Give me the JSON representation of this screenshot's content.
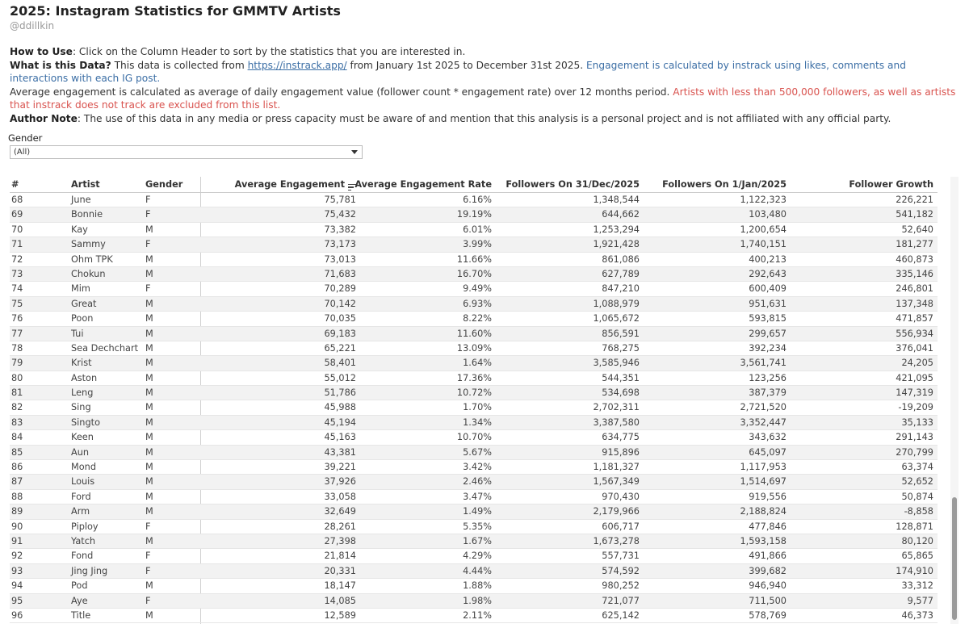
{
  "header": {
    "title": "2025: Instagram Statistics for GMMTV Artists",
    "handle": "@ddillkin"
  },
  "description": {
    "how_label": "How to Use",
    "how_text": ": Click on the Column Header to sort by the statistics that you are interested in.",
    "what_label": "What is this Data?",
    "what_text_1": " This data is collected from ",
    "what_link": "https://instrack.app/",
    "what_text_2": " from January 1st 2025 to December 31st 2025. ",
    "what_engagement": "Engagement is calculated by instrack using likes, comments and interactions with each IG post.",
    "avg_text": "Average engagement is calculated as average of daily engagement value (follower count * engagement rate) over 12 months period. ",
    "avg_red": "Artists with less than 500,000 followers, as well as artists that instrack does not track are excluded from this list.",
    "author_label": "Author Note",
    "author_text": ": The use of this data in any media or press capacity must be aware of and mention that this analysis is a personal project and is not affiliated with any official party."
  },
  "filter": {
    "label": "Gender",
    "value": "(All)"
  },
  "table": {
    "columns": {
      "num": "#",
      "artist": "Artist",
      "gender": "Gender",
      "avg": "Average Engagement",
      "rate": "Average Engagement Rate",
      "f31": "Followers On 31/Dec/2025",
      "f1": "Followers On 1/Jan/2025",
      "growth": "Follower Growth"
    },
    "rows": [
      [
        "68",
        "June",
        "F",
        "75,781",
        "6.16%",
        "1,348,544",
        "1,122,323",
        "226,221"
      ],
      [
        "69",
        "Bonnie",
        "F",
        "75,432",
        "19.19%",
        "644,662",
        "103,480",
        "541,182"
      ],
      [
        "70",
        "Kay",
        "M",
        "73,382",
        "6.01%",
        "1,253,294",
        "1,200,654",
        "52,640"
      ],
      [
        "71",
        "Sammy",
        "F",
        "73,173",
        "3.99%",
        "1,921,428",
        "1,740,151",
        "181,277"
      ],
      [
        "72",
        "Ohm TPK",
        "M",
        "73,013",
        "11.66%",
        "861,086",
        "400,213",
        "460,873"
      ],
      [
        "73",
        "Chokun",
        "M",
        "71,683",
        "16.70%",
        "627,789",
        "292,643",
        "335,146"
      ],
      [
        "74",
        "Mim",
        "F",
        "70,289",
        "9.49%",
        "847,210",
        "600,409",
        "246,801"
      ],
      [
        "75",
        "Great",
        "M",
        "70,142",
        "6.93%",
        "1,088,979",
        "951,631",
        "137,348"
      ],
      [
        "76",
        "Poon",
        "M",
        "70,035",
        "8.22%",
        "1,065,672",
        "593,815",
        "471,857"
      ],
      [
        "77",
        "Tui",
        "M",
        "69,183",
        "11.60%",
        "856,591",
        "299,657",
        "556,934"
      ],
      [
        "78",
        "Sea Dechchart",
        "M",
        "65,221",
        "13.09%",
        "768,275",
        "392,234",
        "376,041"
      ],
      [
        "79",
        "Krist",
        "M",
        "58,401",
        "1.64%",
        "3,585,946",
        "3,561,741",
        "24,205"
      ],
      [
        "80",
        "Aston",
        "M",
        "55,012",
        "17.36%",
        "544,351",
        "123,256",
        "421,095"
      ],
      [
        "81",
        "Leng",
        "M",
        "51,786",
        "10.72%",
        "534,698",
        "387,379",
        "147,319"
      ],
      [
        "82",
        "Sing",
        "M",
        "45,988",
        "1.70%",
        "2,702,311",
        "2,721,520",
        "-19,209"
      ],
      [
        "83",
        "Singto",
        "M",
        "45,194",
        "1.34%",
        "3,387,580",
        "3,352,447",
        "35,133"
      ],
      [
        "84",
        "Keen",
        "M",
        "45,163",
        "10.70%",
        "634,775",
        "343,632",
        "291,143"
      ],
      [
        "85",
        "Aun",
        "M",
        "43,381",
        "5.67%",
        "915,896",
        "645,097",
        "270,799"
      ],
      [
        "86",
        "Mond",
        "M",
        "39,221",
        "3.42%",
        "1,181,327",
        "1,117,953",
        "63,374"
      ],
      [
        "87",
        "Louis",
        "M",
        "37,926",
        "2.46%",
        "1,567,349",
        "1,514,697",
        "52,652"
      ],
      [
        "88",
        "Ford",
        "M",
        "33,058",
        "3.47%",
        "970,430",
        "919,556",
        "50,874"
      ],
      [
        "89",
        "Arm",
        "M",
        "32,649",
        "1.49%",
        "2,179,966",
        "2,188,824",
        "-8,858"
      ],
      [
        "90",
        "Piploy",
        "F",
        "28,261",
        "5.35%",
        "606,717",
        "477,846",
        "128,871"
      ],
      [
        "91",
        "Yatch",
        "M",
        "27,398",
        "1.67%",
        "1,673,278",
        "1,593,158",
        "80,120"
      ],
      [
        "92",
        "Fond",
        "F",
        "21,814",
        "4.29%",
        "557,731",
        "491,866",
        "65,865"
      ],
      [
        "93",
        "Jing Jing",
        "F",
        "20,331",
        "4.44%",
        "574,592",
        "399,682",
        "174,910"
      ],
      [
        "94",
        "Pod",
        "M",
        "18,147",
        "1.88%",
        "980,252",
        "946,940",
        "33,312"
      ],
      [
        "95",
        "Aye",
        "F",
        "14,085",
        "1.98%",
        "721,077",
        "711,500",
        "9,577"
      ],
      [
        "96",
        "Title",
        "M",
        "12,589",
        "2.11%",
        "625,142",
        "578,769",
        "46,373"
      ]
    ]
  }
}
